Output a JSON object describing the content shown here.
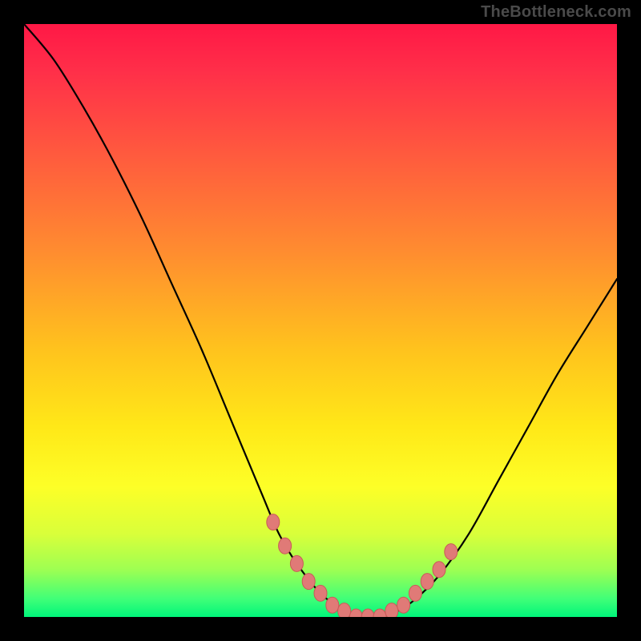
{
  "watermark": "TheBottleneck.com",
  "colors": {
    "background": "#000000",
    "curve": "#000000",
    "dot_fill": "#e07a77",
    "dot_stroke": "#c95a57",
    "gradient_top": "#ff1846",
    "gradient_bottom": "#00f57a"
  },
  "chart_data": {
    "type": "line",
    "title": "",
    "xlabel": "",
    "ylabel": "",
    "xlim": [
      0,
      100
    ],
    "ylim": [
      0,
      100
    ],
    "curve": {
      "name": "bottleneck-curve",
      "x": [
        0,
        5,
        10,
        15,
        20,
        25,
        30,
        35,
        40,
        43,
        46,
        50,
        54,
        57,
        60,
        63,
        66,
        70,
        75,
        80,
        85,
        90,
        95,
        100
      ],
      "y": [
        100,
        94,
        86,
        77,
        67,
        56,
        45,
        33,
        21,
        14,
        9,
        4,
        1,
        0,
        0,
        1,
        3,
        7,
        14,
        23,
        32,
        41,
        49,
        57
      ]
    },
    "dots": {
      "name": "highlighted-points",
      "x": [
        42,
        44,
        46,
        48,
        50,
        52,
        54,
        56,
        58,
        60,
        62,
        64,
        66,
        68,
        70,
        72
      ],
      "y": [
        16,
        12,
        9,
        6,
        4,
        2,
        1,
        0,
        0,
        0,
        1,
        2,
        4,
        6,
        8,
        11
      ]
    }
  }
}
